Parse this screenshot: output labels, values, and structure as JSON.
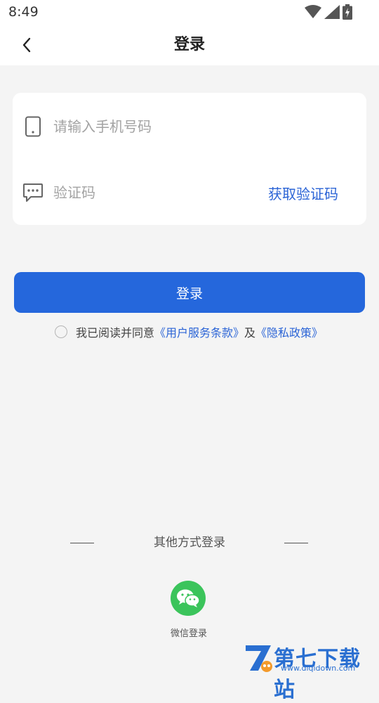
{
  "status_bar": {
    "time": "8:49",
    "icons": [
      "wifi-icon",
      "signal-icon",
      "battery-charging-icon"
    ]
  },
  "nav": {
    "back_icon": "chevron-left-icon",
    "title": "登录"
  },
  "form": {
    "phone": {
      "icon": "phone-icon",
      "placeholder": "请输入手机号码",
      "value": ""
    },
    "code": {
      "icon": "message-icon",
      "placeholder": "验证码",
      "value": "",
      "action_label": "获取验证码"
    }
  },
  "login_button": {
    "label": "登录"
  },
  "agreement": {
    "prefix": "我已阅读并同意",
    "terms_link": "《用户服务条款》",
    "conjunction": "及",
    "privacy_link": "《隐私政策》",
    "checked": false
  },
  "other_login": {
    "heading": "其他方式登录",
    "wechat": {
      "icon": "wechat-icon",
      "label": "微信登录"
    }
  },
  "watermark": {
    "title": "第七下载站",
    "url": "www.diqidown.com"
  },
  "colors": {
    "accent": "#2567dc",
    "link": "#2b64d6",
    "wechat": "#3bc45b",
    "background": "#f4f4f4"
  }
}
